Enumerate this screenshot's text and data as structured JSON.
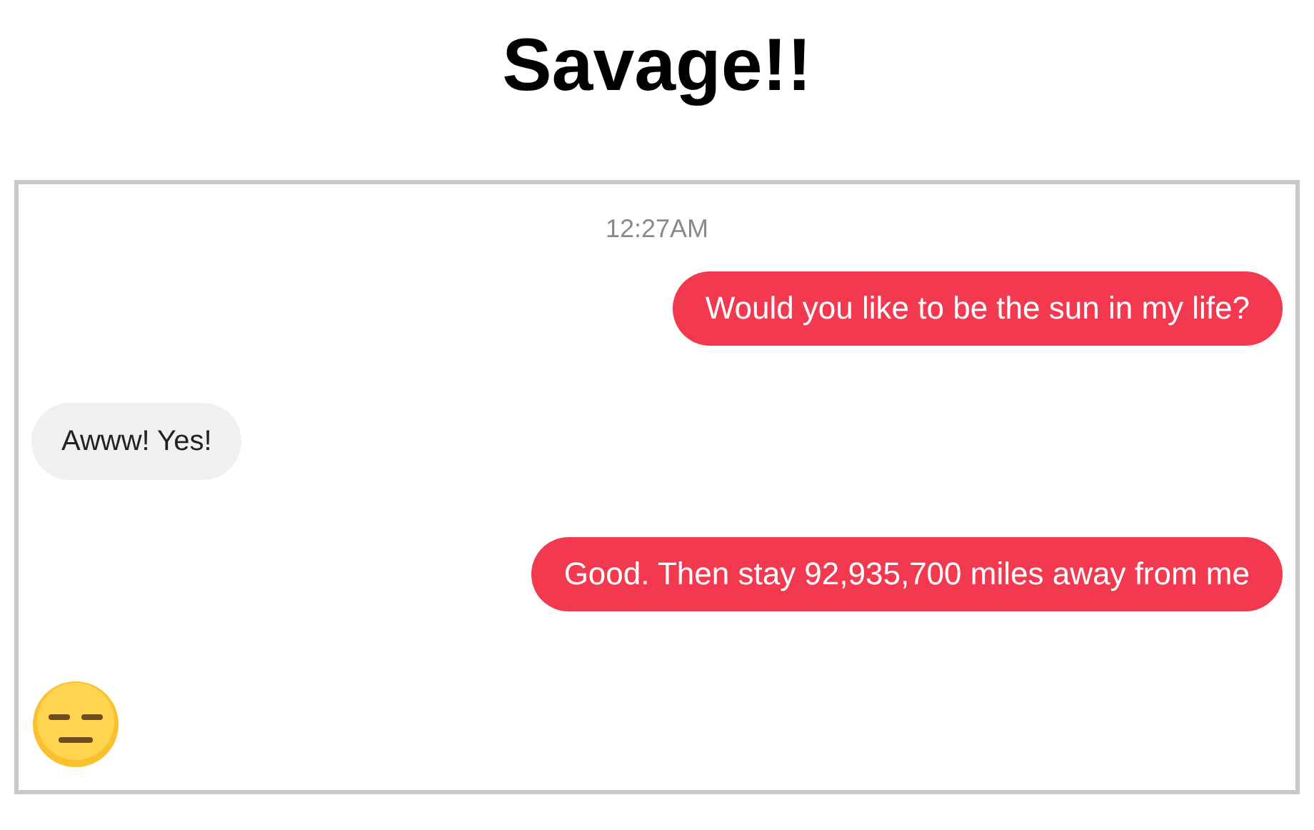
{
  "title": "Savage!!",
  "chat": {
    "timestamp": "12:27AM",
    "messages": [
      {
        "text": "Would you like to be the sun in my life?",
        "kind": "outgoing"
      },
      {
        "text": "Awww! Yes!",
        "kind": "incoming"
      },
      {
        "text": "Good. Then stay 92,935,700 miles away from me",
        "kind": "outgoing"
      }
    ]
  }
}
